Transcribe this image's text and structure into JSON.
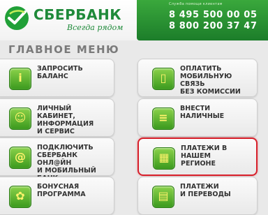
{
  "header": {
    "brand_name": "СБЕРБАНК",
    "slogan": "Всегда рядом",
    "phone_caption": "Служба помощи клиентам",
    "phone1": "8 495 500 00 05",
    "phone2": "8 800 200 37 47"
  },
  "main": {
    "title": "ГЛАВНОЕ МЕНЮ",
    "buttons_left": [
      {
        "label": "ЗАПРОСИТЬ\nБАЛАНС",
        "icon": "info-icon",
        "glyph": "i"
      },
      {
        "label": "ЛИЧНЫЙ КАБИНЕТ,\nИНФОРМАЦИЯ\nИ СЕРВИС",
        "icon": "account-icon",
        "glyph": "☺"
      },
      {
        "label": "ПОДКЛЮЧИТЬ\nСБЕРБАНК ОНЛ@ЙН\nИ МОБИЛЬНЫЙ БАНК",
        "icon": "online-bank-icon",
        "glyph": "@"
      },
      {
        "label": "БОНУСНАЯ\nПРОГРАММА",
        "icon": "gift-icon",
        "glyph": "✿"
      }
    ],
    "buttons_right": [
      {
        "label": "ОПЛАТИТЬ\nМОБИЛЬНУЮ СВЯЗЬ\nБЕЗ КОМИССИИ",
        "icon": "mobile-phone-icon",
        "glyph": "▯"
      },
      {
        "label": "ВНЕСТИ\nНАЛИЧНЫЕ",
        "icon": "cash-icon",
        "glyph": "≡"
      },
      {
        "label": "ПЛАТЕЖИ В НАШЕМ\nРЕГИОНЕ",
        "icon": "calendar-icon",
        "glyph": "▦"
      },
      {
        "label": "ПЛАТЕЖИ\nИ ПЕРЕВОДЫ",
        "icon": "transfer-icon",
        "glyph": "▤"
      }
    ]
  },
  "colors": {
    "brand_green": "#1f8a3a",
    "highlight_red": "#d71f2a"
  }
}
